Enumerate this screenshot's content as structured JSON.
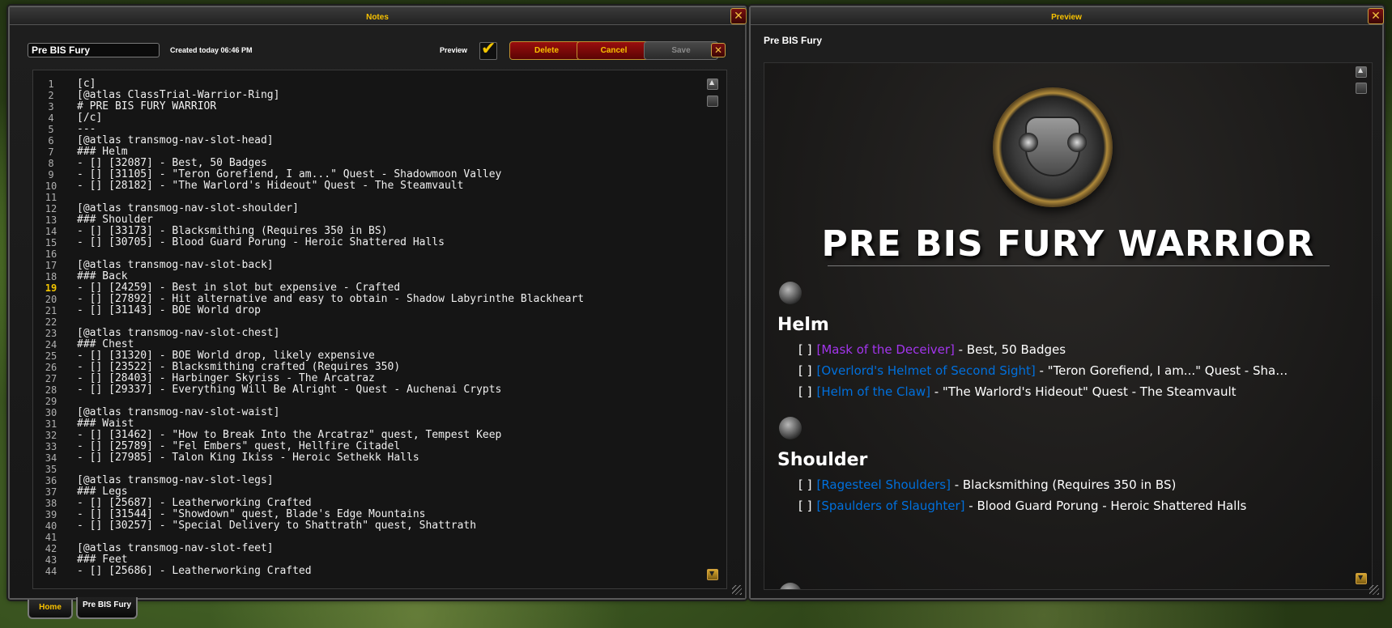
{
  "notes_window": {
    "title": "Notes",
    "close_glyph": "✕",
    "note_name": "Pre BIS Fury",
    "created": "Created today 06:46 PM",
    "preview_label": "Preview",
    "preview_checked": true,
    "delete_label": "Delete",
    "cancel_label": "Cancel",
    "save_label": "Save",
    "active_line": 19,
    "lines": [
      "[c]",
      "[@atlas ClassTrial-Warrior-Ring]",
      "# PRE BIS FURY WARRIOR",
      "[/c]",
      "---",
      "[@atlas transmog-nav-slot-head]",
      "### Helm",
      "- [] [32087] - Best, 50 Badges",
      "- [] [31105] - \"Teron Gorefiend, I am...\" Quest - Shadowmoon Valley",
      "- [] [28182] - \"The Warlord's Hideout\" Quest - The Steamvault",
      "",
      "[@atlas transmog-nav-slot-shoulder]",
      "### Shoulder",
      "- [] [33173] - Blacksmithing (Requires 350 in BS)",
      "- [] [30705] - Blood Guard Porung - Heroic Shattered Halls",
      "",
      "[@atlas transmog-nav-slot-back]",
      "### Back",
      "- [] [24259] - Best in slot but expensive - Crafted",
      "- [] [27892] - Hit alternative and easy to obtain - Shadow Labyrinthe Blackheart",
      "- [] [31143] - BOE World drop",
      "",
      "[@atlas transmog-nav-slot-chest]",
      "### Chest",
      "- [] [31320] - BOE World drop, likely expensive",
      "- [] [23522] - Blacksmithing crafted (Requires 350)",
      "- [] [28403] - Harbinger Skyriss - The Arcatraz",
      "- [] [29337] - Everything Will Be Alright - Quest - Auchenai Crypts",
      "",
      "[@atlas transmog-nav-slot-waist]",
      "### Waist",
      "- [] [31462] - \"How to Break Into the Arcatraz\" quest, Tempest Keep",
      "- [] [25789] - \"Fel Embers\" quest, Hellfire Citadel",
      "- [] [27985] - Talon King Ikiss - Heroic Sethekk Halls",
      "",
      "[@atlas transmog-nav-slot-legs]",
      "### Legs",
      "- [] [25687] - Leatherworking Crafted",
      "- [] [31544] - \"Showdown\" quest, Blade's Edge Mountains",
      "- [] [30257] - \"Special Delivery to Shattrath\" quest, Shattrath",
      "",
      "[@atlas transmog-nav-slot-feet]",
      "### Feet",
      "- [] [25686] - Leatherworking Crafted"
    ]
  },
  "tabs": [
    {
      "label": "Home"
    },
    {
      "label": "Pre BIS Fury"
    }
  ],
  "preview_window": {
    "title": "Preview",
    "close_glyph": "✕",
    "note_title": "Pre BIS Fury",
    "heading": "PRE BIS FURY WARRIOR",
    "sections": [
      {
        "name": "Helm",
        "icon": "helm-icon",
        "items": [
          {
            "box": "[ ]",
            "link": "[Mask of the Deceiver]",
            "link_color": "purple",
            "rest": " - Best, 50 Badges"
          },
          {
            "box": "[ ]",
            "link": "[Overlord's Helmet of Second Sight]",
            "link_color": "blue",
            "rest": " - \"Teron Gorefiend, I am...\" Quest - Shado..."
          },
          {
            "box": "[ ]",
            "link": "[Helm of the Claw]",
            "link_color": "blue",
            "rest": " - \"The Warlord's Hideout\" Quest - The Steamvault"
          }
        ]
      },
      {
        "name": "Shoulder",
        "icon": "shoulder-icon",
        "items": [
          {
            "box": "[ ]",
            "link": "[Ragesteel Shoulders]",
            "link_color": "blue",
            "rest": " - Blacksmithing (Requires 350 in BS)"
          },
          {
            "box": "[ ]",
            "link": "[Spaulders of Slaughter]",
            "link_color": "blue",
            "rest": " - Blood Guard Porung - Heroic Shattered Halls"
          }
        ]
      }
    ]
  },
  "colors": {
    "gold": "#f8c200",
    "epic_purple": "#a335ee",
    "rare_blue": "#0070dd"
  }
}
